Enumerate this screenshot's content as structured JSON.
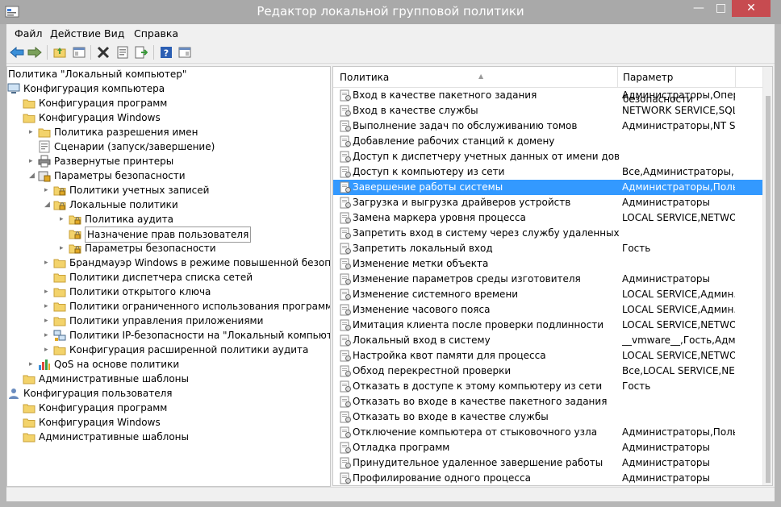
{
  "window": {
    "title": "Редактор локальной групповой политики",
    "minimize": "—",
    "maximize": "□",
    "close": "✕"
  },
  "menu": [
    "Файл",
    "Действие",
    "Вид",
    "Справка"
  ],
  "toolbar": [
    "back-icon",
    "forward-icon",
    "up-folder-icon",
    "show-hide-tree-icon",
    "delete-icon",
    "properties-icon",
    "export-list-icon",
    "help-icon",
    "show-hide-action-pane-icon"
  ],
  "tree": [
    {
      "label": "Политика \"Локальный компьютер\"",
      "level": 0,
      "arrow": "",
      "icon": "none"
    },
    {
      "label": "Конфигурация компьютера",
      "level": 0,
      "arrow": "▸",
      "icon": "computer"
    },
    {
      "label": "Конфигурация программ",
      "level": 1,
      "arrow": "",
      "icon": "folder"
    },
    {
      "label": "Конфигурация Windows",
      "level": 1,
      "arrow": "",
      "icon": "folder"
    },
    {
      "label": "Политика разрешения имен",
      "level": 2,
      "arrow": "▸",
      "icon": "folder"
    },
    {
      "label": "Сценарии (запуск/завершение)",
      "level": 2,
      "arrow": "",
      "icon": "script"
    },
    {
      "label": "Развернутые принтеры",
      "level": 2,
      "arrow": "▸",
      "icon": "printer"
    },
    {
      "label": "Параметры безопасности",
      "level": 2,
      "arrow": "◢",
      "icon": "security"
    },
    {
      "label": "Политики учетных записей",
      "level": 3,
      "arrow": "▸",
      "icon": "folder-lock"
    },
    {
      "label": "Локальные политики",
      "level": 3,
      "arrow": "◢",
      "icon": "folder-lock"
    },
    {
      "label": "Политика аудита",
      "level": 4,
      "arrow": "▸",
      "icon": "folder-lock"
    },
    {
      "label": "Назначение прав пользователя",
      "level": 4,
      "arrow": "",
      "icon": "folder-lock",
      "selected": true
    },
    {
      "label": "Параметры безопасности",
      "level": 4,
      "arrow": "▸",
      "icon": "folder-lock"
    },
    {
      "label": "Брандмауэр Windows в режиме повышенной безопасности",
      "level": 3,
      "arrow": "▸",
      "icon": "folder"
    },
    {
      "label": "Политики диспетчера списка сетей",
      "level": 3,
      "arrow": "",
      "icon": "folder"
    },
    {
      "label": "Политики открытого ключа",
      "level": 3,
      "arrow": "▸",
      "icon": "folder"
    },
    {
      "label": "Политики ограниченного использования программ",
      "level": 3,
      "arrow": "▸",
      "icon": "folder"
    },
    {
      "label": "Политики управления приложениями",
      "level": 3,
      "arrow": "▸",
      "icon": "folder"
    },
    {
      "label": "Политики IP-безопасности на \"Локальный компьютер\"",
      "level": 3,
      "arrow": "▸",
      "icon": "network"
    },
    {
      "label": "Конфигурация расширенной политики аудита",
      "level": 3,
      "arrow": "▸",
      "icon": "folder"
    },
    {
      "label": "QoS на основе политики",
      "level": 2,
      "arrow": "▸",
      "icon": "chart"
    },
    {
      "label": "Административные шаблоны",
      "level": 1,
      "arrow": "",
      "icon": "folder"
    },
    {
      "label": "Конфигурация пользователя",
      "level": 0,
      "arrow": "▸",
      "icon": "user"
    },
    {
      "label": "Конфигурация программ",
      "level": 1,
      "arrow": "",
      "icon": "folder"
    },
    {
      "label": "Конфигурация Windows",
      "level": 1,
      "arrow": "",
      "icon": "folder"
    },
    {
      "label": "Административные шаблоны",
      "level": 1,
      "arrow": "",
      "icon": "folder"
    }
  ],
  "list": {
    "headers": {
      "policy": "Политика",
      "setting": "Параметр безопасности"
    },
    "rows": [
      {
        "name": "Вход в качестве пакетного задания",
        "value": "Администраторы,Опер..."
      },
      {
        "name": "Вход в качестве службы",
        "value": "NETWORK SERVICE,SQL..."
      },
      {
        "name": "Выполнение задач по обслуживанию томов",
        "value": "Администраторы,NT S..."
      },
      {
        "name": "Добавление рабочих станций к домену",
        "value": ""
      },
      {
        "name": "Доступ к диспетчеру учетных данных от имени доверенн...",
        "value": ""
      },
      {
        "name": "Доступ к компьютеру из сети",
        "value": "Все,Администраторы,..."
      },
      {
        "name": "Завершение работы системы",
        "value": "Администраторы,Польз...",
        "selected": true
      },
      {
        "name": "Загрузка и выгрузка драйверов устройств",
        "value": "Администраторы"
      },
      {
        "name": "Замена маркера уровня процесса",
        "value": "LOCAL SERVICE,NETWO..."
      },
      {
        "name": "Запретить вход в систему через службу удаленных рабоч...",
        "value": ""
      },
      {
        "name": "Запретить локальный вход",
        "value": "Гость"
      },
      {
        "name": "Изменение метки объекта",
        "value": ""
      },
      {
        "name": "Изменение параметров среды изготовителя",
        "value": "Администраторы"
      },
      {
        "name": "Изменение системного времени",
        "value": "LOCAL SERVICE,Админ..."
      },
      {
        "name": "Изменение часового пояса",
        "value": "LOCAL SERVICE,Админ..."
      },
      {
        "name": "Имитация клиента после проверки подлинности",
        "value": "LOCAL SERVICE,NETWO..."
      },
      {
        "name": "Локальный вход в систему",
        "value": "__vmware__,Гость,Адми..."
      },
      {
        "name": "Настройка квот памяти для процесса",
        "value": "LOCAL SERVICE,NETWO..."
      },
      {
        "name": "Обход перекрестной проверки",
        "value": "Все,LOCAL SERVICE,NE..."
      },
      {
        "name": "Отказать в доступе к этому компьютеру из сети",
        "value": "Гость"
      },
      {
        "name": "Отказать во входе в качестве пакетного задания",
        "value": ""
      },
      {
        "name": "Отказать во входе в качестве службы",
        "value": ""
      },
      {
        "name": "Отключение компьютера от стыковочного узла",
        "value": "Администраторы,Поль..."
      },
      {
        "name": "Отладка программ",
        "value": "Администраторы"
      },
      {
        "name": "Принудительное удаленное завершение работы",
        "value": "Администраторы"
      },
      {
        "name": "Профилирование одного процесса",
        "value": "Администраторы"
      }
    ]
  },
  "colors": {
    "selection": "#3399ff",
    "titlebar": "#a9a9a9",
    "close": "#c74b50",
    "folder": "#f3d36b"
  }
}
